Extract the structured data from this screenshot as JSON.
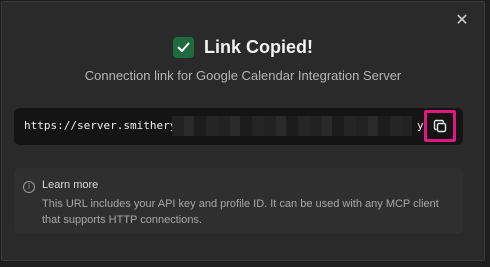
{
  "dialog": {
    "title": "Link Copied!",
    "subtitle": "Connection link for Google Calendar Integration Server",
    "close_icon": "close-icon",
    "check_icon": "check-icon"
  },
  "url_field": {
    "visible_start": "https://server.smithery",
    "visible_end": "y",
    "copy_icon": "copy-icon"
  },
  "info": {
    "icon": "info-icon",
    "title": "Learn more",
    "text": "This URL includes your API key and profile ID. It can be used with any MCP client that supports HTTP connections."
  },
  "colors": {
    "accent_highlight": "#e0177f",
    "success_badge": "#1f6b3f",
    "background": "#2a2a2a"
  }
}
